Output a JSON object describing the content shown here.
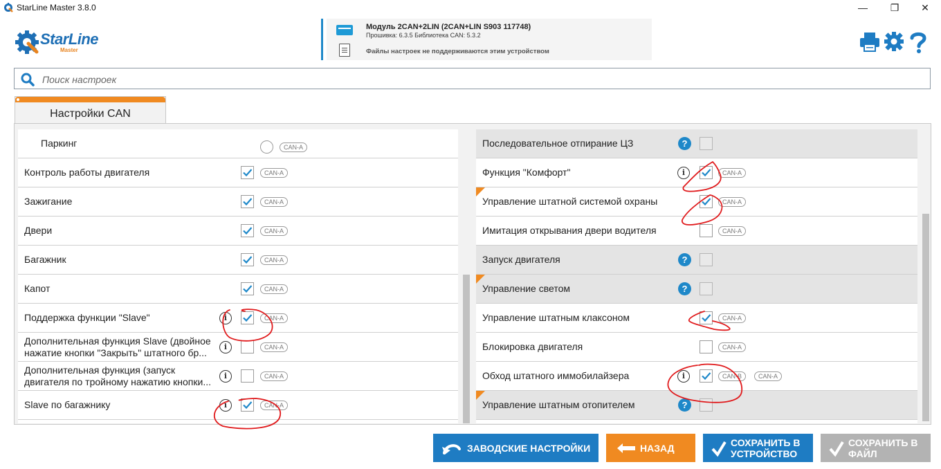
{
  "window": {
    "title": "StarLine Master 3.8.0",
    "minimize": "—",
    "maximize": "❐",
    "close": "✕"
  },
  "logo": {
    "brand": "StarLine",
    "sub": "Master"
  },
  "device": {
    "title": "Модуль 2CAN+2LIN (2CAN+LIN S903 117748)",
    "firmware": "Прошивка: 6.3.5   Библиотека CAN: 5.3.2",
    "files_note": "Файлы настроек не поддерживаются этим устройством"
  },
  "header_icons": [
    "printer-icon",
    "gear-icon",
    "help-icon"
  ],
  "search": {
    "placeholder": "Поиск настроек",
    "value": ""
  },
  "tab": {
    "label": "Настройки CAN"
  },
  "left_rows": [
    {
      "label": "Паркинг",
      "control": "radio",
      "checked": false,
      "info": false,
      "badge": "CAN-A"
    },
    {
      "label": "Контроль работы двигателя",
      "control": "checkbox",
      "checked": true,
      "info": false,
      "badge": "CAN-A"
    },
    {
      "label": "Зажигание",
      "control": "checkbox",
      "checked": true,
      "info": false,
      "badge": "CAN-A"
    },
    {
      "label": "Двери",
      "control": "checkbox",
      "checked": true,
      "info": false,
      "badge": "CAN-A"
    },
    {
      "label": "Багажник",
      "control": "checkbox",
      "checked": true,
      "info": false,
      "badge": "CAN-A"
    },
    {
      "label": "Капот",
      "control": "checkbox",
      "checked": true,
      "info": false,
      "badge": "CAN-A"
    },
    {
      "label": "Поддержка функции \"Slave\"",
      "control": "checkbox",
      "checked": true,
      "info": true,
      "badge": "CAN-A"
    },
    {
      "label_line1": "Дополнительная функция Slave (двойное",
      "label_line2": "нажатие кнопки \"Закрыть\" штатного бр...",
      "control": "checkbox",
      "checked": false,
      "info": true,
      "badge": "CAN-A"
    },
    {
      "label_line1": "Дополнительная функция (запуск",
      "label_line2": "двигателя по тройному нажатию кнопки...",
      "control": "checkbox",
      "checked": false,
      "info": true,
      "badge": "CAN-A"
    },
    {
      "label": "Slave по багажнику",
      "control": "checkbox",
      "checked": true,
      "info": true,
      "badge": "CAN-A"
    }
  ],
  "right_rows": [
    {
      "label": "Последовательное отпирание ЦЗ",
      "grey": true,
      "corner": false,
      "help": true,
      "info": false,
      "checked": false,
      "disabled": true,
      "badges": []
    },
    {
      "label": "Функция \"Комфорт\"",
      "grey": false,
      "corner": false,
      "help": false,
      "info": true,
      "checked": true,
      "disabled": false,
      "badges": [
        "CAN-A"
      ]
    },
    {
      "label": "Управление штатной системой охраны",
      "grey": false,
      "corner": true,
      "help": false,
      "info": false,
      "checked": true,
      "disabled": false,
      "badges": [
        "CAN-A"
      ]
    },
    {
      "label": "Имитация открывания двери водителя",
      "grey": false,
      "corner": false,
      "help": false,
      "info": false,
      "checked": false,
      "disabled": false,
      "badges": [
        "CAN-A"
      ]
    },
    {
      "label": "Запуск двигателя",
      "grey": true,
      "corner": false,
      "help": true,
      "info": false,
      "checked": false,
      "disabled": true,
      "badges": []
    },
    {
      "label": "Управление светом",
      "grey": true,
      "corner": true,
      "help": true,
      "info": false,
      "checked": false,
      "disabled": true,
      "badges": []
    },
    {
      "label": "Управление штатным клаксоном",
      "grey": false,
      "corner": false,
      "help": false,
      "info": false,
      "checked": true,
      "disabled": false,
      "badges": [
        "CAN-A"
      ]
    },
    {
      "label": "Блокировка двигателя",
      "grey": false,
      "corner": false,
      "help": false,
      "info": false,
      "checked": false,
      "disabled": false,
      "badges": [
        "CAN-A"
      ]
    },
    {
      "label": "Обход штатного иммобилайзера",
      "grey": false,
      "corner": false,
      "help": false,
      "info": true,
      "checked": true,
      "disabled": false,
      "badges": [
        "CAN-B",
        "CAN-A"
      ]
    },
    {
      "label": "Управление штатным отопителем",
      "grey": true,
      "corner": true,
      "help": true,
      "info": false,
      "checked": false,
      "disabled": true,
      "badges": []
    }
  ],
  "buttons": {
    "factory": "ЗАВОДСКИЕ НАСТРОЙКИ",
    "back": "НАЗАД",
    "save_device_1": "СОХРАНИТЬ В",
    "save_device_2": "УСТРОЙСТВО",
    "save_file_1": "СОХРАНИТЬ В",
    "save_file_2": "ФАЙЛ"
  },
  "colors": {
    "accent_blue": "#1e7cc3",
    "accent_orange": "#f08a21",
    "annotation_red": "#e0191b"
  }
}
